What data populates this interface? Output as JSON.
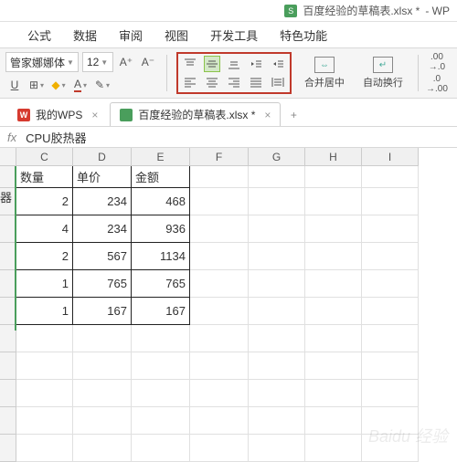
{
  "title": {
    "filename": "百度经验的草稿表.xlsx *",
    "app": "- WP"
  },
  "menu": {
    "formula": "公式",
    "data": "数据",
    "review": "审阅",
    "view": "视图",
    "dev": "开发工具",
    "special": "特色功能"
  },
  "font": {
    "name": "管家娜娜体",
    "size": "12"
  },
  "buttons": {
    "merge": "合并居中",
    "wrap": "自动换行"
  },
  "decimals": {
    "inc": ".00",
    "dec": ".0"
  },
  "tabs": {
    "wps": "我的WPS",
    "doc": "百度经验的草稿表.xlsx *"
  },
  "fx": {
    "label": "fx",
    "value": "CPU胶热器"
  },
  "cols": [
    "C",
    "D",
    "E",
    "F",
    "G",
    "H",
    "I"
  ],
  "widths": [
    62,
    64,
    64,
    64,
    62,
    62,
    62
  ],
  "headers": {
    "qty": "数量",
    "price": "单价",
    "amount": "金额",
    "item": "器"
  },
  "data": [
    {
      "qty": 2,
      "price": 234,
      "amount": 468
    },
    {
      "qty": 4,
      "price": 234,
      "amount": 936
    },
    {
      "qty": 2,
      "price": 567,
      "amount": 1134
    },
    {
      "qty": 1,
      "price": 765,
      "amount": 765
    },
    {
      "qty": 1,
      "price": 167,
      "amount": 167
    }
  ],
  "watermark": "Baidu 经验"
}
